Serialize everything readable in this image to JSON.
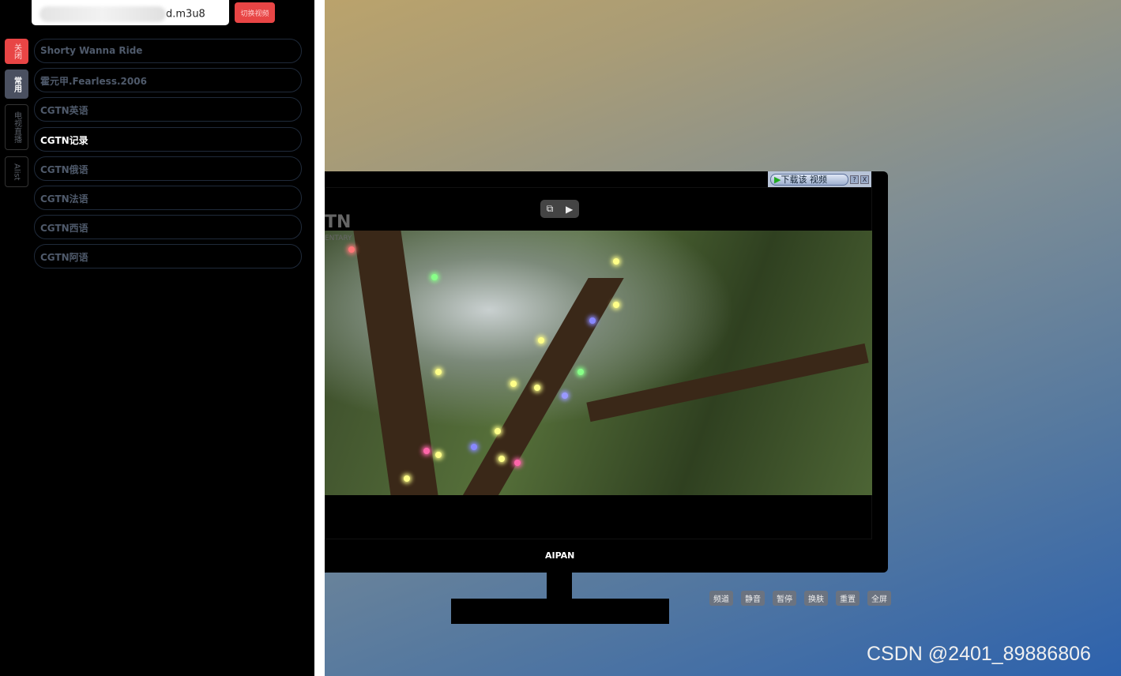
{
  "url_input": {
    "value_visible": "d.m3u8"
  },
  "switch_button": "切换视频",
  "tabs": [
    {
      "label": "关闭",
      "bg": "#e84545",
      "color": "#ffdede"
    },
    {
      "label": "常用",
      "bg": "#4a5060",
      "color": "#ffffff"
    },
    {
      "label": "电视直播",
      "bg": "#000000",
      "color": "#5a5f68"
    },
    {
      "label": "Alist",
      "bg": "#000000",
      "color": "#5a5f68"
    }
  ],
  "playlist": [
    {
      "label": "Shorty Wanna Ride",
      "active": false
    },
    {
      "label": "霍元甲.Fearless.2006",
      "active": false
    },
    {
      "label": "CGTN英语",
      "active": false
    },
    {
      "label": "CGTN记录",
      "active": true
    },
    {
      "label": "CGTN俄语",
      "active": false
    },
    {
      "label": "CGTN法语",
      "active": false
    },
    {
      "label": "CGTN西语",
      "active": false
    },
    {
      "label": "CGTN阿语",
      "active": false
    }
  ],
  "video": {
    "channel_logo": "TN",
    "channel_sub": "ENTARY",
    "controls": [
      "pip-icon",
      "cast-icon"
    ]
  },
  "download_bar": {
    "label": "下载该 视频",
    "help": "?",
    "close": "X"
  },
  "monitor_brand": "AIPAN",
  "controls": [
    "频道",
    "静音",
    "暂停",
    "换肤",
    "重置",
    "全屏"
  ],
  "watermark": "CSDN @2401_89886806"
}
